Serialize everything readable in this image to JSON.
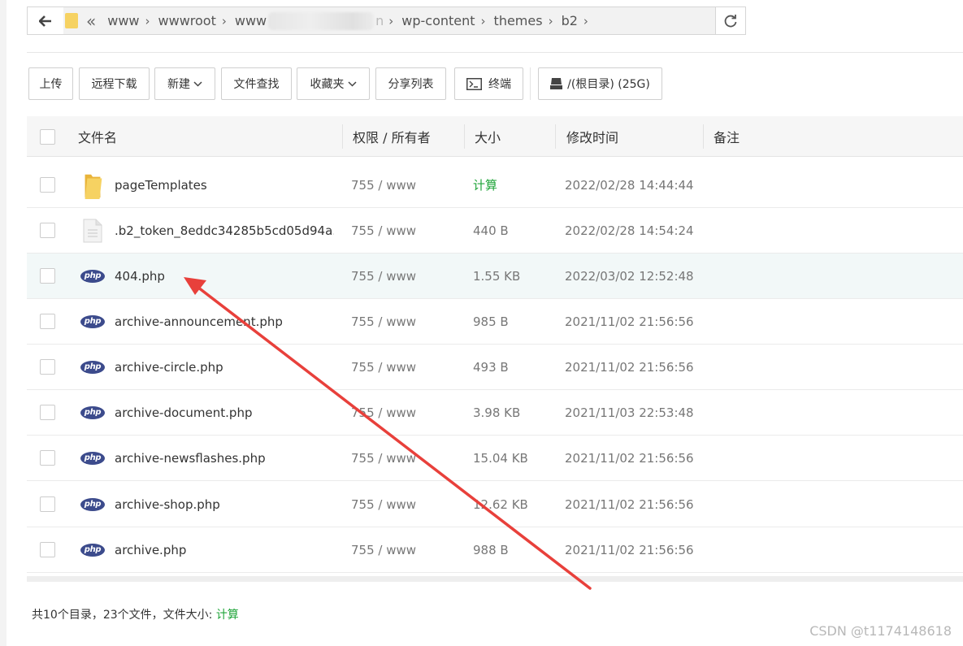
{
  "address_bar": {
    "crumbs": [
      "www",
      "wwwroot",
      "www",
      "wp-content",
      "themes",
      "b2"
    ],
    "overflow_glyph": "«",
    "partially_hidden_tail": "n"
  },
  "toolbar": {
    "upload": "上传",
    "remote_download": "远程下载",
    "new": "新建",
    "find_file": "文件查找",
    "favorites": "收藏夹",
    "share_list": "分享列表",
    "terminal": "终端",
    "disk": "/(根目录) (25G)"
  },
  "table": {
    "headers": {
      "name": "文件名",
      "perm": "权限 / 所有者",
      "size": "大小",
      "mtime": "修改时间",
      "note": "备注"
    },
    "rows": [
      {
        "icon": "folder-icon",
        "name": "pageTemplates",
        "perm": "755 / www",
        "size": "计算",
        "mtime": "2022/02/28 14:44:44"
      },
      {
        "icon": "file-icon",
        "name": ".b2_token_8eddc34285b5cd05d94a...",
        "perm": "755 / www",
        "size": "440 B",
        "mtime": "2022/02/28 14:54:24"
      },
      {
        "icon": "php-icon",
        "name": "404.php",
        "perm": "755 / www",
        "size": "1.55 KB",
        "mtime": "2022/03/02 12:52:48"
      },
      {
        "icon": "php-icon",
        "name": "archive-announcement.php",
        "perm": "755 / www",
        "size": "985 B",
        "mtime": "2021/11/02 21:56:56"
      },
      {
        "icon": "php-icon",
        "name": "archive-circle.php",
        "perm": "755 / www",
        "size": "493 B",
        "mtime": "2021/11/02 21:56:56"
      },
      {
        "icon": "php-icon",
        "name": "archive-document.php",
        "perm": "755 / www",
        "size": "3.98 KB",
        "mtime": "2021/11/03 22:53:48"
      },
      {
        "icon": "php-icon",
        "name": "archive-newsflashes.php",
        "perm": "755 / www",
        "size": "15.04 KB",
        "mtime": "2021/11/02 21:56:56"
      },
      {
        "icon": "php-icon",
        "name": "archive-shop.php",
        "perm": "755 / www",
        "size": "12.62 KB",
        "mtime": "2021/11/02 21:56:56"
      },
      {
        "icon": "php-icon",
        "name": "archive.php",
        "perm": "755 / www",
        "size": "988 B",
        "mtime": "2021/11/02 21:56:56"
      }
    ],
    "php_icon_text": "php"
  },
  "footer": {
    "summary": "共10个目录，23个文件，文件大小:",
    "calc_link": "计算"
  },
  "watermark": "CSDN @t1174148618",
  "colors": {
    "accent_green": "#20a53a",
    "php_badge": "#3c4b8c",
    "folder": "#f6d262",
    "annotation_arrow": "#e8403b",
    "row_highlight": "#f2f8f8"
  }
}
